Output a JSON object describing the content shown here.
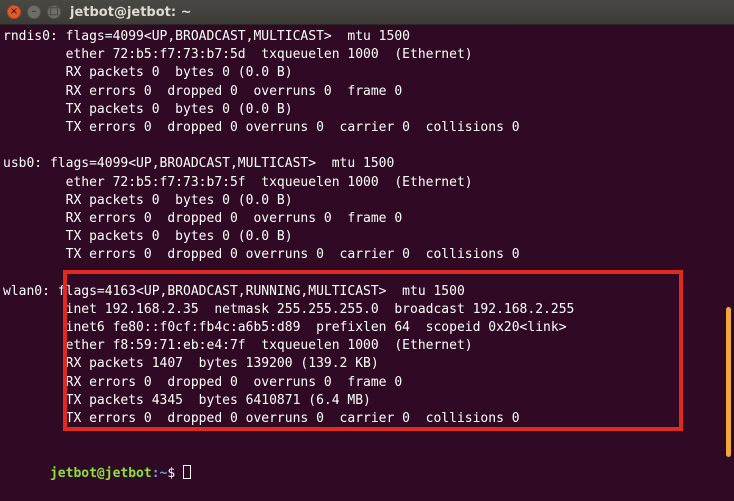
{
  "window": {
    "title": "jetbot@jetbot: ~",
    "close_glyph": "×",
    "minimize_glyph": "–",
    "maximize_glyph": "□"
  },
  "colors": {
    "background": "#300a24",
    "text": "#ffffff",
    "prompt_user": "#8ae234",
    "prompt_path": "#729fcf",
    "highlight_border": "#e02a1f"
  },
  "terminal": {
    "lines": [
      "rndis0: flags=4099<UP,BROADCAST,MULTICAST>  mtu 1500",
      "        ether 72:b5:f7:73:b7:5d  txqueuelen 1000  (Ethernet)",
      "        RX packets 0  bytes 0 (0.0 B)",
      "        RX errors 0  dropped 0  overruns 0  frame 0",
      "        TX packets 0  bytes 0 (0.0 B)",
      "        TX errors 0  dropped 0 overruns 0  carrier 0  collisions 0",
      "",
      "usb0: flags=4099<UP,BROADCAST,MULTICAST>  mtu 1500",
      "        ether 72:b5:f7:73:b7:5f  txqueuelen 1000  (Ethernet)",
      "        RX packets 0  bytes 0 (0.0 B)",
      "        RX errors 0  dropped 0  overruns 0  frame 0",
      "        TX packets 0  bytes 0 (0.0 B)",
      "        TX errors 0  dropped 0 overruns 0  carrier 0  collisions 0",
      "",
      "wlan0: flags=4163<UP,BROADCAST,RUNNING,MULTICAST>  mtu 1500",
      "        inet 192.168.2.35  netmask 255.255.255.0  broadcast 192.168.2.255",
      "        inet6 fe80::f0cf:fb4c:a6b5:d89  prefixlen 64  scopeid 0x20<link>",
      "        ether f8:59:71:eb:e4:7f  txqueuelen 1000  (Ethernet)",
      "        RX packets 1407  bytes 139200 (139.2 KB)",
      "        RX errors 0  dropped 0  overruns 0  frame 0",
      "        TX packets 4345  bytes 6410871 (6.4 MB)",
      "        TX errors 0  dropped 0 overruns 0  carrier 0  collisions 0",
      ""
    ],
    "prompt": {
      "user_host": "jetbot@jetbot",
      "path": ":~",
      "symbol": "$ "
    }
  }
}
